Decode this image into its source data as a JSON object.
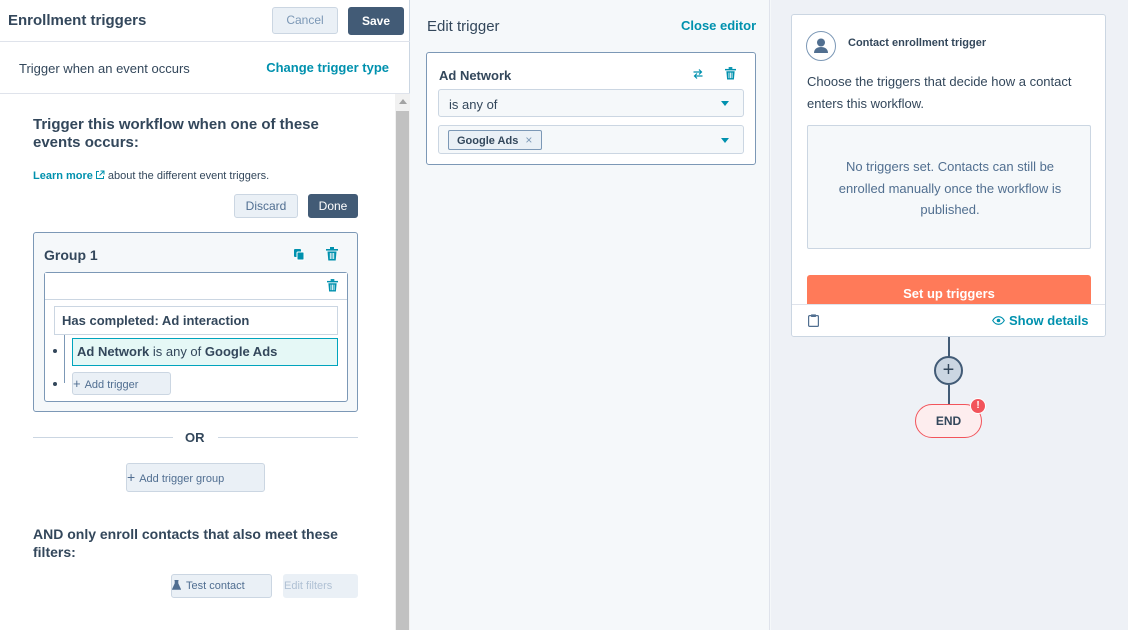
{
  "left": {
    "title": "Enrollment triggers",
    "cancel_label": "Cancel",
    "save_label": "Save",
    "trigger_type_text": "Trigger when an event occurs",
    "change_trigger_type": "Change trigger type",
    "workflow_heading": "Trigger this workflow when one of these events occurs:",
    "learn_more": "Learn more",
    "learn_more_suffix": "about the different event triggers.",
    "discard_label": "Discard",
    "done_label": "Done",
    "group": {
      "title": "Group 1",
      "event": "Has completed: Ad interaction",
      "criteria": {
        "property": "Ad Network",
        "operator": "is any of",
        "value": "Google Ads"
      },
      "add_trigger_label": "Add trigger"
    },
    "or_label": "OR",
    "add_trigger_group_label": "Add trigger group",
    "and_heading": "AND only enroll contacts that also meet these filters:",
    "test_contact_label": "Test contact",
    "edit_filters_label": "Edit filters"
  },
  "editor": {
    "title": "Edit trigger",
    "close_label": "Close editor",
    "property": "Ad Network",
    "operator_value": "is any of",
    "selected_tags": [
      "Google Ads"
    ]
  },
  "canvas": {
    "card_title": "Contact enrollment trigger",
    "description": "Choose the triggers that decide how a contact enters this workflow.",
    "empty_text": "No triggers set. Contacts can still be enrolled manually once the workflow is published.",
    "setup_label": "Set up triggers",
    "show_details_label": "Show details",
    "plus_label": "+",
    "end_label": "END",
    "end_badge": "!"
  },
  "icons": {
    "external": "external-link-icon",
    "copy": "copy-icon",
    "delete": "trash-icon",
    "swap": "swap-icon",
    "caret": "chevron-down-icon",
    "remove": "close-icon",
    "beaker": "beaker-icon",
    "plus": "plus-icon",
    "avatar": "person-icon",
    "clipboard": "clipboard-icon",
    "eye": "eye-icon"
  },
  "colors": {
    "primary_dark": "#425b76",
    "link": "#0091ae",
    "accent_orange": "#ff7a59",
    "alert_red": "#f2545b",
    "selected_teal": "#00a4bd"
  }
}
